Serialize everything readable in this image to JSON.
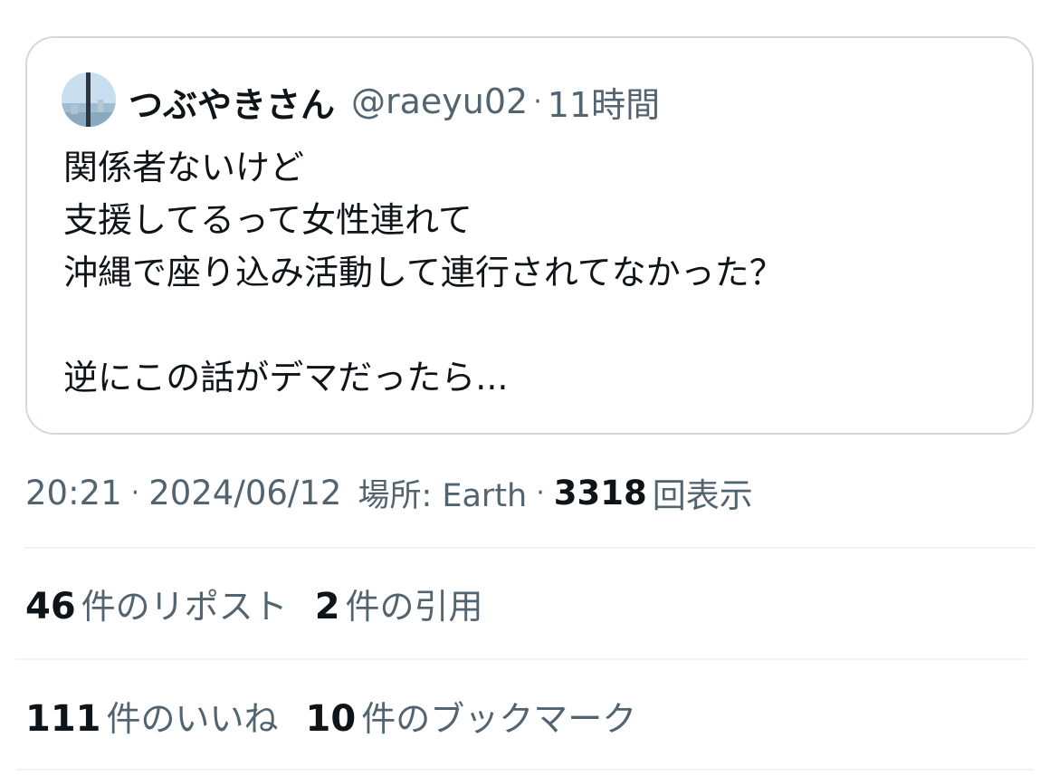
{
  "quoted_tweet": {
    "display_name": "つぶやきさん",
    "handle": "@raeyu02",
    "separator": "·",
    "relative_time": "11時間",
    "lines": [
      "関係者ないけど",
      "支援してるって女性連れて",
      "沖縄で座り込み活動して連行されてなかった？",
      "",
      "逆にこの話がデマだったら..."
    ],
    "avatar_icon": "avatar-photo-icon"
  },
  "meta": {
    "time": "20:21",
    "separator": "·",
    "date": "2024/06/12",
    "place_label": "場所: Earth",
    "views_count": "3318",
    "views_label": "回表示"
  },
  "stats": {
    "reposts_count": "46",
    "reposts_label": "件のリポスト",
    "quotes_count": "2",
    "quotes_label": "件の引用",
    "likes_count": "111",
    "likes_label": "件のいいね",
    "bookmarks_count": "10",
    "bookmarks_label": "件のブックマーク"
  },
  "colors": {
    "text_primary": "#0f1419",
    "text_secondary": "#536471",
    "border": "#cfd9de",
    "divider": "#eff3f4"
  }
}
